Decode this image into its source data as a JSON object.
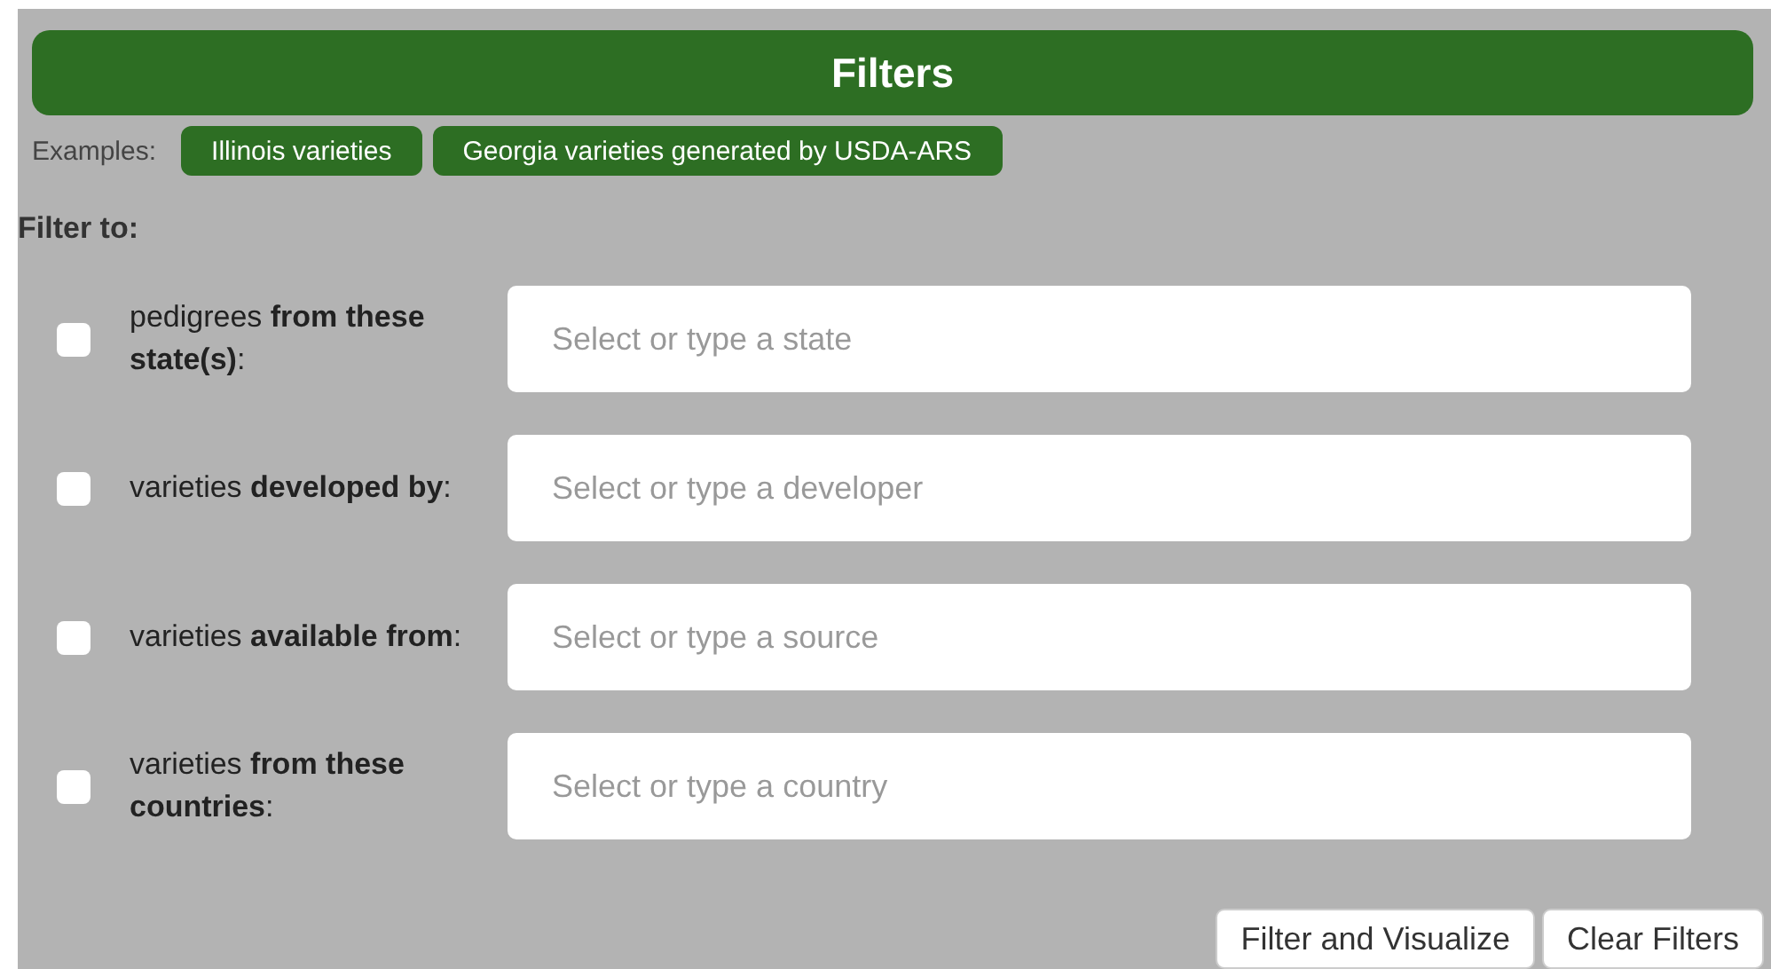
{
  "header": {
    "title": "Filters"
  },
  "examples": {
    "label": "Examples:",
    "items": [
      "Illinois varieties",
      "Georgia varieties generated by USDA-ARS"
    ]
  },
  "filter_heading": "Filter to:",
  "filters": [
    {
      "label": "pedigrees **from these state(s)**:",
      "checked": false,
      "placeholder": "Select or type a state"
    },
    {
      "label": "varieties **developed by**:",
      "checked": false,
      "placeholder": "Select or type a developer"
    },
    {
      "label": "varieties **available from**:",
      "checked": false,
      "placeholder": "Select or type a source"
    },
    {
      "label": "varieties **from these countries**:",
      "checked": false,
      "placeholder": "Select or type a country"
    }
  ],
  "buttons": [
    "Filter and Visualize",
    "Clear Filters"
  ]
}
